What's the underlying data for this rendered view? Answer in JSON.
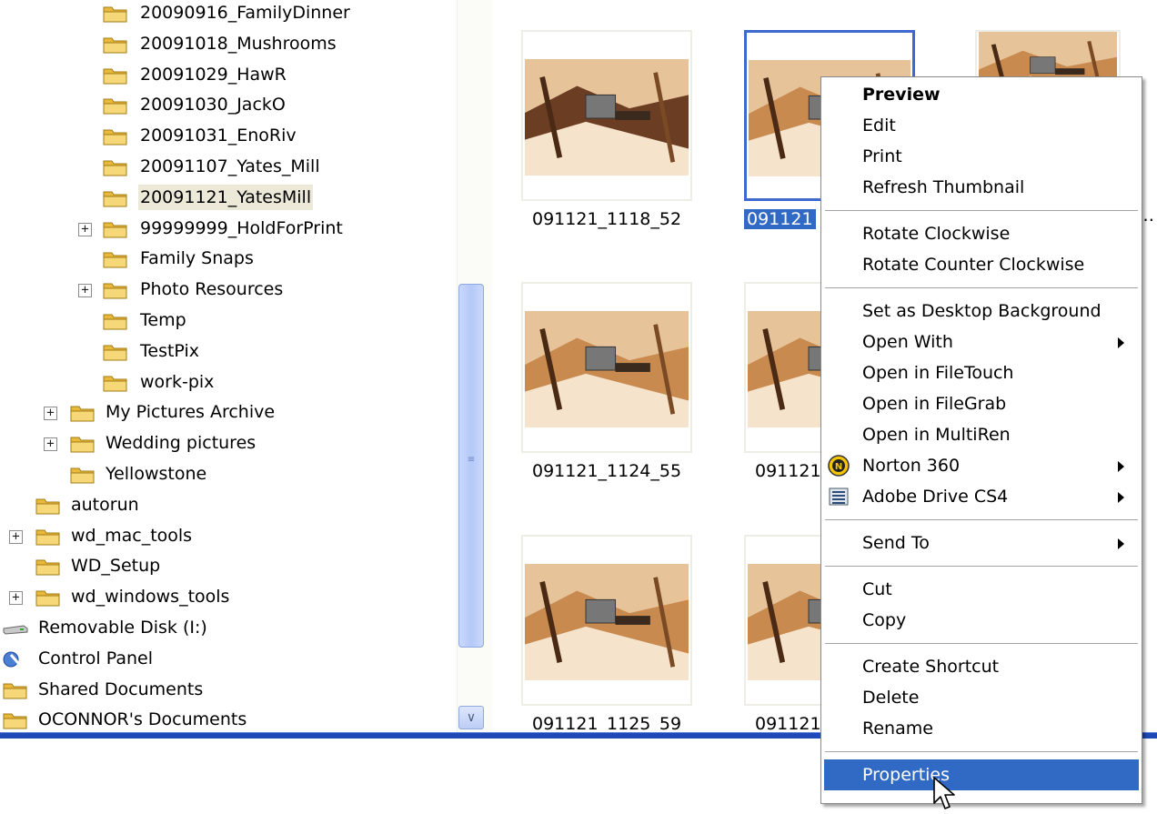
{
  "tree": [
    {
      "label": "20090916_FamilyDinner",
      "icon": "folder-icon",
      "expander": null,
      "selected": false
    },
    {
      "label": "20091018_Mushrooms",
      "icon": "folder-icon",
      "expander": null,
      "selected": false
    },
    {
      "label": "20091029_HawR",
      "icon": "folder-icon",
      "expander": null,
      "selected": false
    },
    {
      "label": "20091030_JackO",
      "icon": "folder-icon",
      "expander": null,
      "selected": false
    },
    {
      "label": "20091031_EnoRiv",
      "icon": "folder-icon",
      "expander": null,
      "selected": false
    },
    {
      "label": "20091107_Yates_Mill",
      "icon": "folder-icon",
      "expander": null,
      "selected": false
    },
    {
      "label": "20091121_YatesMill",
      "icon": "folder-icon",
      "expander": null,
      "selected": true
    },
    {
      "label": "99999999_HoldForPrint",
      "icon": "folder-icon",
      "expander": "+",
      "selected": false
    },
    {
      "label": "Family Snaps",
      "icon": "folder-icon",
      "expander": null,
      "selected": false
    },
    {
      "label": "Photo Resources",
      "icon": "folder-icon",
      "expander": "+",
      "selected": false
    },
    {
      "label": "Temp",
      "icon": "folder-icon",
      "expander": null,
      "selected": false
    },
    {
      "label": "TestPix",
      "icon": "folder-icon",
      "expander": null,
      "selected": false
    },
    {
      "label": "work-pix",
      "icon": "folder-icon",
      "expander": null,
      "selected": false
    },
    {
      "label": "My Pictures Archive",
      "icon": "folder-icon",
      "expander": "+",
      "selected": false
    },
    {
      "label": "Wedding pictures",
      "icon": "folder-icon",
      "expander": "+",
      "selected": false
    },
    {
      "label": "Yellowstone",
      "icon": "folder-icon",
      "expander": null,
      "selected": false
    },
    {
      "label": "autorun",
      "icon": "folder-icon",
      "expander": null,
      "selected": false
    },
    {
      "label": "wd_mac_tools",
      "icon": "folder-icon",
      "expander": "+",
      "selected": false
    },
    {
      "label": "WD_Setup",
      "icon": "folder-icon",
      "expander": null,
      "selected": false
    },
    {
      "label": "wd_windows_tools",
      "icon": "folder-icon",
      "expander": "+",
      "selected": false
    },
    {
      "label": "Removable Disk (I:)",
      "icon": "removable-disk-icon",
      "expander": null,
      "selected": false
    },
    {
      "label": "Control Panel",
      "icon": "control-panel-icon",
      "expander": null,
      "selected": false
    },
    {
      "label": "Shared Documents",
      "icon": "folder-icon",
      "expander": null,
      "selected": false
    },
    {
      "label": "OCONNOR's Documents",
      "icon": "folder-icon",
      "expander": null,
      "selected": false
    }
  ],
  "thumbnails": [
    {
      "caption": "091121_1118_52",
      "selected": false
    },
    {
      "caption": "091121",
      "selected": true
    },
    {
      "caption": "",
      "selected": false
    },
    {
      "caption": "091121_1124_55",
      "selected": false
    },
    {
      "caption": "091121",
      "selected": false
    },
    {
      "caption": "",
      "selected": false
    },
    {
      "caption": "091121_1125_59",
      "selected": false
    },
    {
      "caption": "091121",
      "selected": false
    },
    {
      "caption": "",
      "selected": false
    }
  ],
  "context_menu": {
    "items": [
      {
        "label": "Preview",
        "bold": true
      },
      {
        "label": "Edit"
      },
      {
        "label": "Print"
      },
      {
        "label": "Refresh Thumbnail"
      },
      {
        "separator": true
      },
      {
        "label": "Rotate Clockwise"
      },
      {
        "label": "Rotate Counter Clockwise"
      },
      {
        "separator": true
      },
      {
        "label": "Set as Desktop Background"
      },
      {
        "label": "Open With",
        "submenu": true
      },
      {
        "label": "Open in FileTouch"
      },
      {
        "label": "Open in FileGrab"
      },
      {
        "label": "Open in MultiRen"
      },
      {
        "label": "Norton 360",
        "submenu": true,
        "icon": "norton-icon"
      },
      {
        "label": "Adobe Drive CS4",
        "submenu": true,
        "icon": "adobe-drive-icon"
      },
      {
        "separator": true
      },
      {
        "label": "Send To",
        "submenu": true
      },
      {
        "separator": true
      },
      {
        "label": "Cut"
      },
      {
        "label": "Copy"
      },
      {
        "separator": true
      },
      {
        "label": "Create Shortcut"
      },
      {
        "label": "Delete"
      },
      {
        "label": "Rename"
      },
      {
        "separator": true
      },
      {
        "label": "Properties",
        "highlighted": true
      }
    ]
  },
  "colors": {
    "selection_blue": "#316ac5",
    "folder_yellow": "#f3d26a",
    "taskbar_blue": "#1f49b6"
  }
}
